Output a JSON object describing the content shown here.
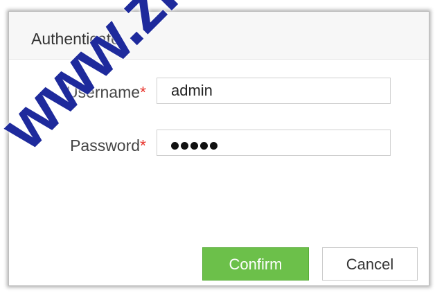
{
  "dialog": {
    "title": "Authenticate",
    "fields": {
      "username": {
        "label": "Username",
        "required_mark": "*",
        "value": "admin"
      },
      "password": {
        "label": "Password",
        "required_mark": "*",
        "masked_length": 5
      }
    },
    "buttons": {
      "confirm_label": "Confirm",
      "cancel_label": "Cancel"
    }
  },
  "watermark": {
    "text": "www.zktec"
  },
  "colors": {
    "confirm_button": "#6cc04a",
    "required_mark": "#e8332b",
    "watermark": "#1e2a9c"
  }
}
